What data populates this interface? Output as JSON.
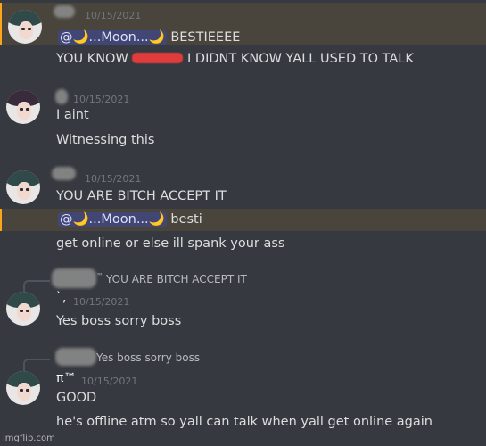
{
  "messages": [
    {
      "timestamp": "10/15/2021",
      "mention": "@🌙...Moon...🌙",
      "mention_text": " BESTIEEEE",
      "line2": "YOU KNOW",
      "line2_rest": " I DIDNT KNOW YALL USED TO TALK"
    },
    {
      "timestamp": "10/15/2021",
      "line1": "I aint",
      "line2": "Witnessing this"
    },
    {
      "timestamp": "10/15/2021",
      "line1": "YOU ARE BITCH ACCEPT IT",
      "mention": "@🌙...Moon...🌙",
      "mention_text": " besti",
      "line3": "get online or else ill spank your ass"
    },
    {
      "reply_preview": "YOU ARE BITCH ACCEPT IT",
      "reply_prefix": "™",
      "username": "`,",
      "timestamp": "10/15/2021",
      "line1": "Yes boss sorry boss"
    },
    {
      "reply_preview": "Yes boss sorry boss",
      "username": "π™",
      "timestamp": "10/15/2021",
      "line1": "GOOD",
      "line2": "he's offline atm so yall can talk when yall get online again"
    }
  ],
  "watermark": "imgflip.com"
}
